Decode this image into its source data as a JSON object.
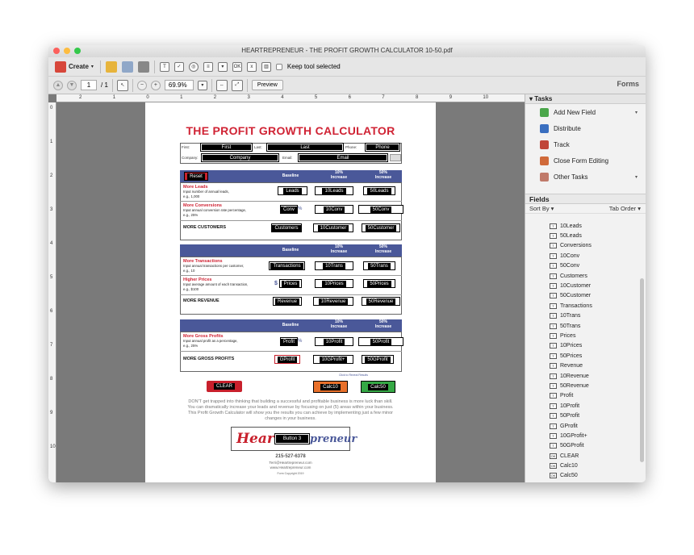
{
  "window": {
    "title": "HEARTREPRENEUR - THE PROFIT GROWTH CALCULATOR 10-50.pdf"
  },
  "toolbar": {
    "create_label": "Create",
    "keep_tool_label": "Keep tool selected",
    "forms_label": "Forms"
  },
  "nav": {
    "page_current": "1",
    "page_total": "/ 1",
    "zoom": "69.9%",
    "preview_label": "Preview"
  },
  "ruler": {
    "h": [
      "2",
      "1",
      "0",
      "1",
      "2",
      "3",
      "4",
      "5",
      "6",
      "7",
      "8",
      "9",
      "10"
    ],
    "v": [
      "0",
      "1",
      "2",
      "3",
      "4",
      "5",
      "6",
      "7",
      "8",
      "9",
      "10"
    ]
  },
  "doc": {
    "title": "THE PROFIT GROWTH CALCULATOR",
    "contact": {
      "first_label": "First:",
      "first_field": "First",
      "last_label": "Last:",
      "last_field": "Last",
      "phone_label": "Phone:",
      "phone_field": "Phone",
      "company_label": "Company:",
      "company_field": "Company",
      "email_label": "Email:",
      "email_field": "Email"
    },
    "cols": {
      "baseline": "Baseline",
      "ten_a": "10%",
      "ten_b": "Increase",
      "fifty_a": "50%",
      "fifty_b": "Increase"
    },
    "reset": "Reset",
    "leads": {
      "title": "More Leads",
      "desc1": "Input number of annual leads,",
      "desc2": "e.g., 1,000",
      "f1": "Leads",
      "f2": "10Leads",
      "f3": "50Leads"
    },
    "conv": {
      "title": "More Conversions",
      "desc1": "Input annual conversion rate percentage,",
      "desc2": "e.g., 25%",
      "f1": "Conv",
      "pct": "%",
      "f2": "10Conv",
      "f3": "50Conv"
    },
    "customers": {
      "title": "MORE CUSTOMERS",
      "f1": "Customers",
      "f2": "10Customer",
      "f3": "50Customer"
    },
    "trans": {
      "title": "More Transactions",
      "desc1": "Input annual transactions per customer,",
      "desc2": "e.g., 10",
      "f1": "Transactions",
      "f2": "10Trans",
      "f3": "50Trans"
    },
    "prices": {
      "title": "Higher Prices",
      "desc1": "Input average amount of each transaction,",
      "desc2": "e.g., $100",
      "dollar": "$",
      "f1": "Prices",
      "f2": "10Prices",
      "f3": "50Prices"
    },
    "revenue": {
      "title": "MORE REVENUE",
      "f1": "Revenue",
      "f2": "10Revenue",
      "f3": "50Revenue"
    },
    "gross": {
      "title": "More Gross Profits",
      "desc1": "Input annual profit as a percentage,",
      "desc2": "e.g., 25%",
      "f1": "Profit",
      "pct": "%",
      "f2": "10Profit",
      "f3": "50Profit"
    },
    "grossp": {
      "title": "MORE GROSS PROFITS",
      "f1": "GProfit",
      "f2": "10GProfit+",
      "f3": "50GProfit"
    },
    "click_reveal": "Click to Reveal Results",
    "clear_btn": "CLEAR",
    "calc10": "Calc10",
    "calc50": "Calc50",
    "para": "DON'T get trapped into thinking that building a successful and profitable business is more luck than skill. You can dramatically increase your leads and revenue by focusing on just (5) areas within your business. This Profit Growth Calculator will show you the results you can achieve by implementing just a few minor changes in your business.",
    "logo_left": "Heart",
    "logo_button": "Button 3",
    "logo_right": "preneur",
    "phone": "215-527-6378",
    "email": "Terri@Heartrepreneur.com",
    "site": "www.Heartrepreneur.com",
    "copyright": "Form Copyright 2019"
  },
  "tasks": {
    "header": "Tasks",
    "items": [
      "Add New Field",
      "Distribute",
      "Track",
      "Close Form Editing",
      "Other Tasks"
    ]
  },
  "fields": {
    "header": "Fields",
    "sort_by": "Sort By",
    "tab_order": "Tab Order",
    "items": [
      "10Leads",
      "50Leads",
      "Conversions",
      "10Conv",
      "50Conv",
      "Customers",
      "10Customer",
      "50Customer",
      "Transactions",
      "10Trans",
      "50Trans",
      "Prices",
      "10Prices",
      "50Prices",
      "Revenue",
      "10Revenue",
      "50Revenue",
      "Profit",
      "10Profit",
      "50Profit",
      "GProfit",
      "10GProfit+",
      "50GProfit",
      "CLEAR",
      "Calc10",
      "Calc50"
    ]
  },
  "colors": {
    "brand_red": "#d02334",
    "header_blue": "#4a5899",
    "orange": "#e8702a",
    "green": "#35a845"
  }
}
